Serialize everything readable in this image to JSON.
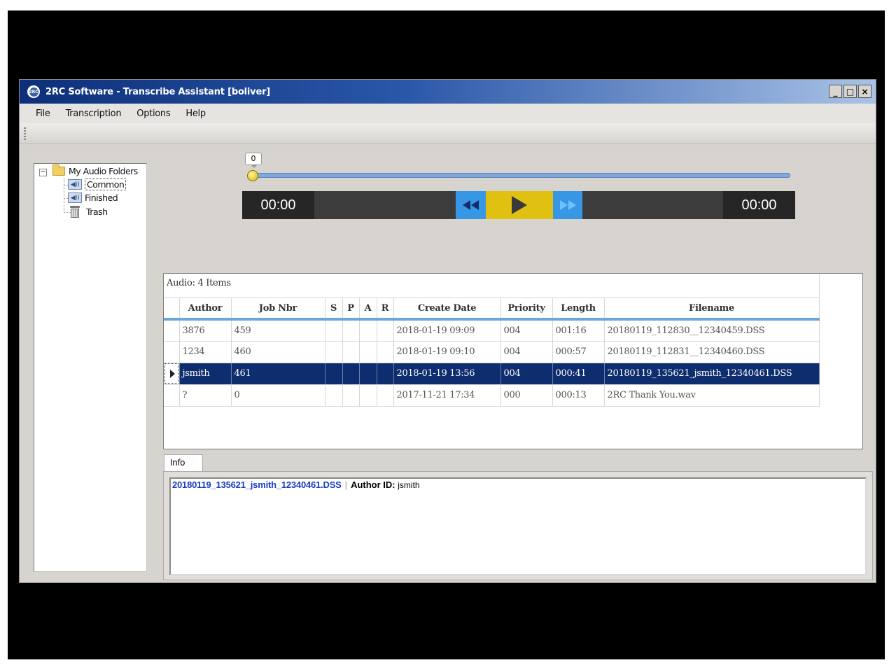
{
  "window": {
    "title": "2RC Software - Transcribe Assistant [boliver]",
    "app_icon_text": "2RC",
    "minimize": "_",
    "maximize": "□",
    "close": "×"
  },
  "menu": {
    "items": [
      "File",
      "Transcription",
      "Options",
      "Help"
    ]
  },
  "tree": {
    "expander": "−",
    "root": "My Audio Folders",
    "children": [
      "Common",
      "Finished",
      "Trash"
    ],
    "selected": "Common"
  },
  "player": {
    "position_value": "0",
    "elapsed": "00:00",
    "total": "00:00",
    "rewind_icon": "rewind-icon",
    "play_icon": "play-icon",
    "forward_icon": "fast-forward-icon"
  },
  "grid": {
    "caption": "Audio: 4 Items",
    "columns": [
      "Author",
      "Job Nbr",
      "S",
      "P",
      "A",
      "R",
      "Create Date",
      "Priority",
      "Length",
      "Filename"
    ],
    "rows": [
      {
        "author": "3876",
        "job": "459",
        "s": "",
        "p": "",
        "a": "",
        "r": "",
        "date": "2018-01-19 09:09",
        "priority": "004",
        "length": "001:16",
        "filename": "20180119_112830__12340459.DSS"
      },
      {
        "author": "1234",
        "job": "460",
        "s": "",
        "p": "",
        "a": "",
        "r": "",
        "date": "2018-01-19 09:10",
        "priority": "004",
        "length": "000:57",
        "filename": "20180119_112831__12340460.DSS"
      },
      {
        "author": "jsmith",
        "job": "461",
        "s": "",
        "p": "",
        "a": "",
        "r": "",
        "date": "2018-01-19 13:56",
        "priority": "004",
        "length": "000:41",
        "filename": "20180119_135621_jsmith_12340461.DSS"
      },
      {
        "author": "?",
        "job": "0",
        "s": "",
        "p": "",
        "a": "",
        "r": "",
        "date": "2017-11-21 17:34",
        "priority": "000",
        "length": "000:13",
        "filename": "2RC Thank You.wav"
      }
    ],
    "selected_row": 2,
    "header_accent": "#6aa6d9",
    "selection_color": "#0e2d6e"
  },
  "info": {
    "tab_label": "Info",
    "filename": "20180119_135621_jsmith_12340461.DSS",
    "separator": "|",
    "author_label": "Author ID:",
    "author_value": "jsmith"
  }
}
